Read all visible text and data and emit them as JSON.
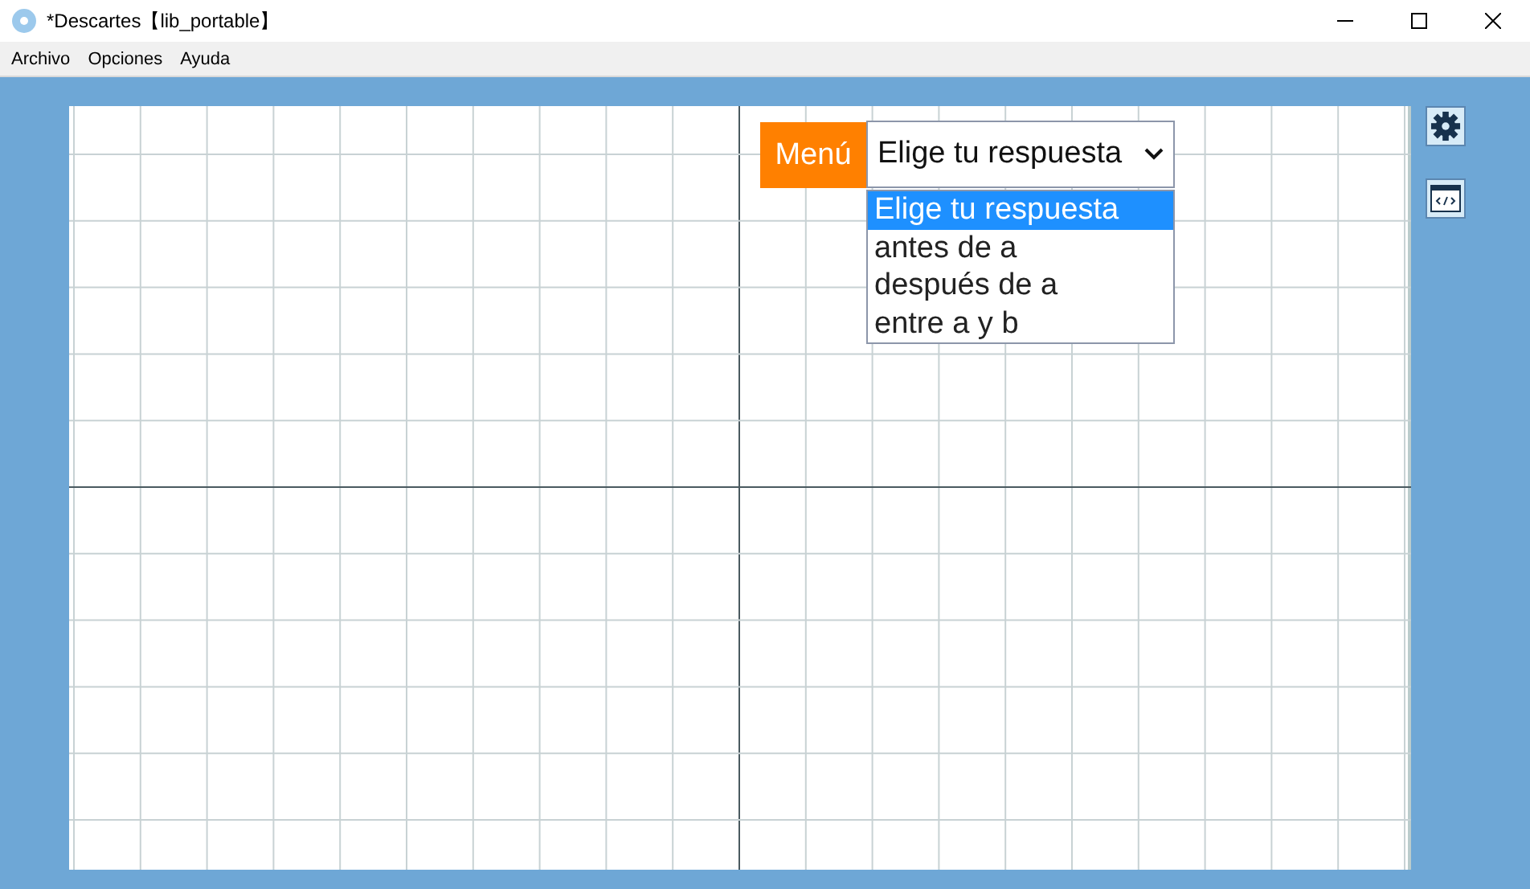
{
  "window": {
    "title": "*Descartes【lib_portable】"
  },
  "menu_bar": [
    "Archivo",
    "Opciones",
    "Ayuda"
  ],
  "scene": {
    "menu_label": "Menú",
    "select": {
      "value": "Elige tu respuesta",
      "expanded": true,
      "options": [
        {
          "label": "Elige tu respuesta",
          "selected": true
        },
        {
          "label": "antes de a",
          "selected": false
        },
        {
          "label": "después de a",
          "selected": false
        },
        {
          "label": "entre a y b",
          "selected": false
        }
      ]
    }
  }
}
